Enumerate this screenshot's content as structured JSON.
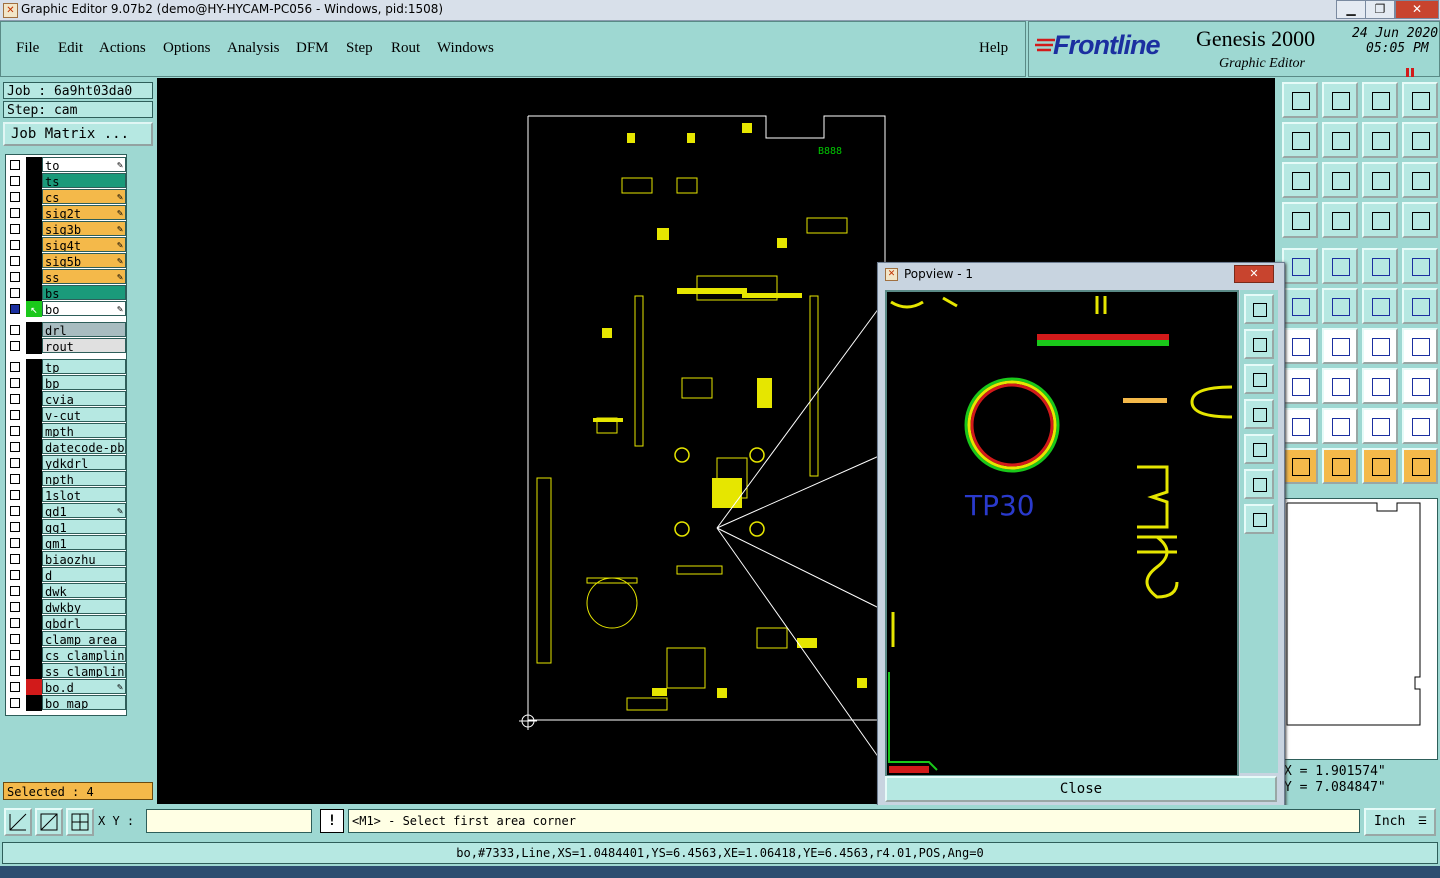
{
  "window": {
    "title": "Graphic Editor 9.07b2 (demo@HY-HYCAM-PC056 - Windows, pid:1508)",
    "min": "▁",
    "max": "❐",
    "close": "✕"
  },
  "menubar": {
    "items": [
      "File",
      "Edit",
      "Actions",
      "Options",
      "Analysis",
      "DFM",
      "Step",
      "Rout",
      "Windows"
    ],
    "help": "Help"
  },
  "brand": {
    "logo": "Frontline",
    "product": "Genesis 2000",
    "subtitle": "Graphic Editor",
    "date": "24 Jun 2020",
    "time": "05:05 PM"
  },
  "job": {
    "job_label": "Job : 6a9ht03da0",
    "step_label": "Step: cam",
    "job_matrix": "Job Matrix ..."
  },
  "layers": [
    {
      "name": "to",
      "color": "#ffffff",
      "edit": true
    },
    {
      "name": "ts",
      "color": "#1a9a7a",
      "edit": false
    },
    {
      "name": "cs",
      "color": "#f4b94a",
      "edit": true
    },
    {
      "name": "sig2t",
      "color": "#f4b94a",
      "edit": true
    },
    {
      "name": "sig3b",
      "color": "#f4b94a",
      "edit": true
    },
    {
      "name": "sig4t",
      "color": "#f4b94a",
      "edit": true
    },
    {
      "name": "sig5b",
      "color": "#f4b94a",
      "edit": true
    },
    {
      "name": "ss",
      "color": "#f4b94a",
      "edit": true
    },
    {
      "name": "bs",
      "color": "#1a9a7a",
      "edit": false
    },
    {
      "name": "bo",
      "color": "#ffffff",
      "edit": true,
      "active": true
    },
    {
      "name": "drl",
      "color": "#a8bcc0",
      "edit": false,
      "gap": true
    },
    {
      "name": "rout",
      "color": "#e0e0e0",
      "edit": false
    },
    {
      "name": "tp",
      "color": "#b6e8e2",
      "edit": false,
      "gap": true
    },
    {
      "name": "bp",
      "color": "#b6e8e2",
      "edit": false
    },
    {
      "name": "cvia",
      "color": "#b6e8e2",
      "edit": false
    },
    {
      "name": "v-cut",
      "color": "#b6e8e2",
      "edit": false
    },
    {
      "name": "mpth",
      "color": "#b6e8e2",
      "edit": false
    },
    {
      "name": "datecode-pbc",
      "color": "#b6e8e2",
      "edit": false
    },
    {
      "name": "ydkdrl",
      "color": "#b6e8e2",
      "edit": false
    },
    {
      "name": "npth",
      "color": "#b6e8e2",
      "edit": false
    },
    {
      "name": "1slot",
      "color": "#b6e8e2",
      "edit": false
    },
    {
      "name": "gd1",
      "color": "#b6e8e2",
      "edit": true
    },
    {
      "name": "gg1",
      "color": "#b6e8e2",
      "edit": false
    },
    {
      "name": "gm1",
      "color": "#b6e8e2",
      "edit": false
    },
    {
      "name": "biaozhu",
      "color": "#b6e8e2",
      "edit": false
    },
    {
      "name": "d",
      "color": "#b6e8e2",
      "edit": false
    },
    {
      "name": "dwk",
      "color": "#b6e8e2",
      "edit": false
    },
    {
      "name": "dwkby",
      "color": "#b6e8e2",
      "edit": false
    },
    {
      "name": "gbdrl",
      "color": "#b6e8e2",
      "edit": false
    },
    {
      "name": "clamp_area",
      "color": "#b6e8e2",
      "edit": false
    },
    {
      "name": "cs_clampline",
      "color": "#b6e8e2",
      "edit": false
    },
    {
      "name": "ss_clampline",
      "color": "#b6e8e2",
      "edit": false
    },
    {
      "name": "bo.d",
      "color": "#b6e8e2",
      "edit": true,
      "red": true
    },
    {
      "name": "bo_map",
      "color": "#b6e8e2",
      "edit": false
    }
  ],
  "selected_label": "Selected : 4",
  "popview": {
    "title": "Popview - 1",
    "close_label": "Close",
    "tp_label": "TP30"
  },
  "canvas": {
    "board_label": "B888"
  },
  "coords": {
    "x": "X = 1.901574\"",
    "y": "Y = 7.084847\""
  },
  "cmd": {
    "xy_label": "X Y :",
    "xy_value": "",
    "excl": "!",
    "prompt": "<M1> - Select first area corner",
    "units": "Inch"
  },
  "status": "bo,#7333,Line,XS=1.0484401,YS=6.4563,XE=1.06418,YE=6.4563,r4.01,POS,Ang=0",
  "colors": {
    "panel": "#9ed8d2",
    "canvas": "#000000",
    "accent": "#f4b94a",
    "pcb": "#e6e600"
  }
}
